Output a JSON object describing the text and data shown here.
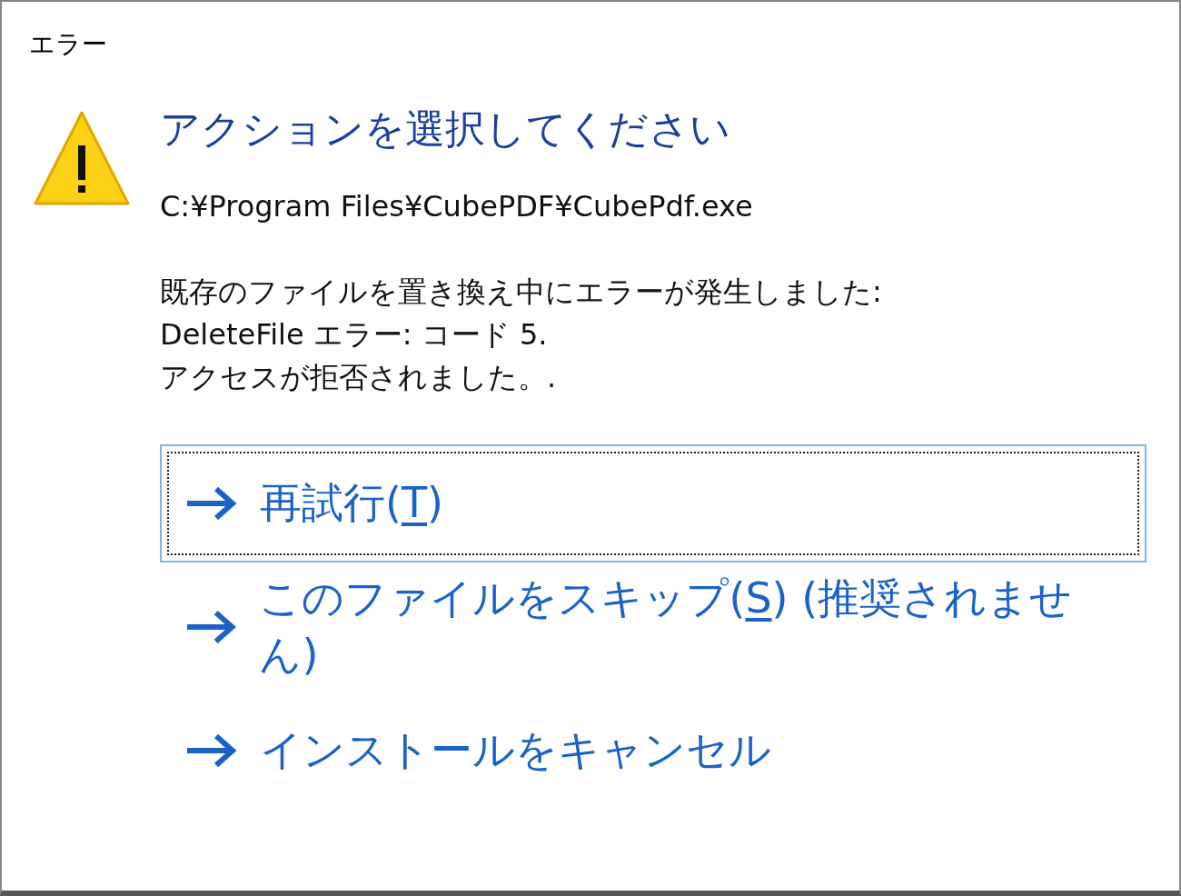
{
  "window": {
    "title": "エラー"
  },
  "heading": "アクションを選択してください",
  "path": "C:¥Program Files¥CubePDF¥CubePdf.exe",
  "message_lines": [
    "既存のファイルを置き換え中にエラーが発生しました:",
    "DeleteFile エラー: コード 5.",
    "アクセスが拒否されました。."
  ],
  "actions": [
    {
      "before": "再試行(",
      "mnemonic": "T",
      "after": ")",
      "focused": true
    },
    {
      "before": "このファイルをスキップ(",
      "mnemonic": "S",
      "after": ") (推奨されません)",
      "focused": false
    },
    {
      "before": "インストールをキャンセル",
      "focused": false
    }
  ]
}
